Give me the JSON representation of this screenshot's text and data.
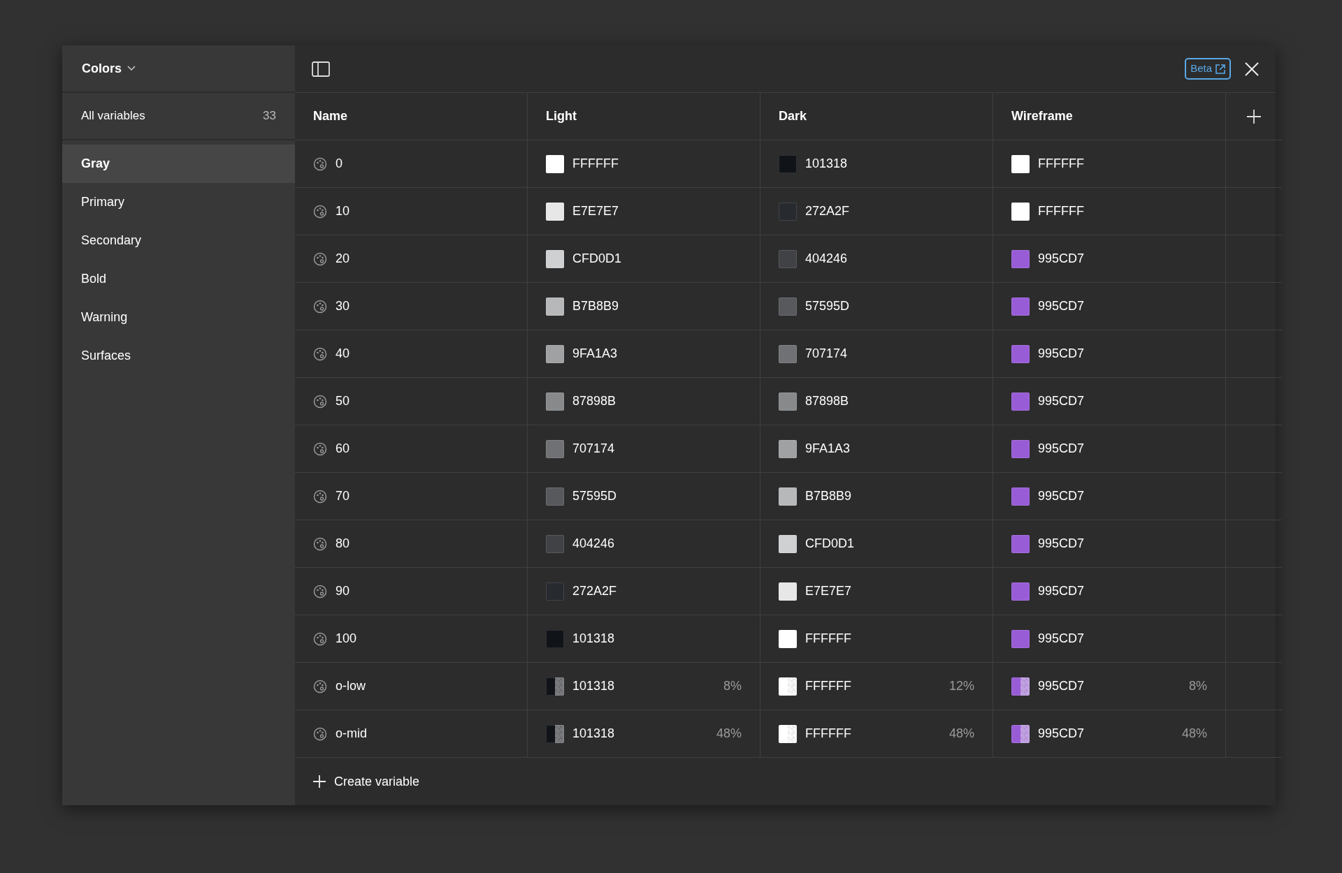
{
  "collection": {
    "title": "Colors"
  },
  "sidebar": {
    "all": {
      "label": "All variables",
      "count": "33"
    },
    "groups": [
      {
        "label": "Gray",
        "selected": true
      },
      {
        "label": "Primary",
        "selected": false
      },
      {
        "label": "Secondary",
        "selected": false
      },
      {
        "label": "Bold",
        "selected": false
      },
      {
        "label": "Warning",
        "selected": false
      },
      {
        "label": "Surfaces",
        "selected": false
      }
    ]
  },
  "toolbar": {
    "badge": "Beta"
  },
  "table": {
    "columns": [
      "Name",
      "Light",
      "Dark",
      "Wireframe"
    ],
    "rows": [
      {
        "name": "0",
        "values": [
          {
            "hex": "FFFFFF",
            "color": "#ffffff"
          },
          {
            "hex": "101318",
            "color": "#101318"
          },
          {
            "hex": "FFFFFF",
            "color": "#ffffff"
          }
        ]
      },
      {
        "name": "10",
        "values": [
          {
            "hex": "E7E7E7",
            "color": "#e7e7e7"
          },
          {
            "hex": "272A2F",
            "color": "#272a2f"
          },
          {
            "hex": "FFFFFF",
            "color": "#ffffff"
          }
        ]
      },
      {
        "name": "20",
        "values": [
          {
            "hex": "CFD0D1",
            "color": "#cfd0d1"
          },
          {
            "hex": "404246",
            "color": "#404246"
          },
          {
            "hex": "995CD7",
            "color": "#995cd7"
          }
        ]
      },
      {
        "name": "30",
        "values": [
          {
            "hex": "B7B8B9",
            "color": "#b7b8b9"
          },
          {
            "hex": "57595D",
            "color": "#57595d"
          },
          {
            "hex": "995CD7",
            "color": "#995cd7"
          }
        ]
      },
      {
        "name": "40",
        "values": [
          {
            "hex": "9FA1A3",
            "color": "#9fa1a3"
          },
          {
            "hex": "707174",
            "color": "#707174"
          },
          {
            "hex": "995CD7",
            "color": "#995cd7"
          }
        ]
      },
      {
        "name": "50",
        "values": [
          {
            "hex": "87898B",
            "color": "#87898b"
          },
          {
            "hex": "87898B",
            "color": "#87898b"
          },
          {
            "hex": "995CD7",
            "color": "#995cd7"
          }
        ]
      },
      {
        "name": "60",
        "values": [
          {
            "hex": "707174",
            "color": "#707174"
          },
          {
            "hex": "9FA1A3",
            "color": "#9fa1a3"
          },
          {
            "hex": "995CD7",
            "color": "#995cd7"
          }
        ]
      },
      {
        "name": "70",
        "values": [
          {
            "hex": "57595D",
            "color": "#57595d"
          },
          {
            "hex": "B7B8B9",
            "color": "#b7b8b9"
          },
          {
            "hex": "995CD7",
            "color": "#995cd7"
          }
        ]
      },
      {
        "name": "80",
        "values": [
          {
            "hex": "404246",
            "color": "#404246"
          },
          {
            "hex": "CFD0D1",
            "color": "#cfd0d1"
          },
          {
            "hex": "995CD7",
            "color": "#995cd7"
          }
        ]
      },
      {
        "name": "90",
        "values": [
          {
            "hex": "272A2F",
            "color": "#272a2f"
          },
          {
            "hex": "E7E7E7",
            "color": "#e7e7e7"
          },
          {
            "hex": "995CD7",
            "color": "#995cd7"
          }
        ]
      },
      {
        "name": "100",
        "values": [
          {
            "hex": "101318",
            "color": "#101318"
          },
          {
            "hex": "FFFFFF",
            "color": "#ffffff"
          },
          {
            "hex": "995CD7",
            "color": "#995cd7"
          }
        ]
      },
      {
        "name": "o-low",
        "values": [
          {
            "hex": "101318",
            "color": "#101318",
            "opacity": "8%"
          },
          {
            "hex": "FFFFFF",
            "color": "#ffffff",
            "opacity": "12%"
          },
          {
            "hex": "995CD7",
            "color": "#995cd7",
            "opacity": "8%"
          }
        ]
      },
      {
        "name": "o-mid",
        "values": [
          {
            "hex": "101318",
            "color": "#101318",
            "opacity": "48%"
          },
          {
            "hex": "FFFFFF",
            "color": "#ffffff",
            "opacity": "48%"
          },
          {
            "hex": "995CD7",
            "color": "#995cd7",
            "opacity": "48%"
          }
        ]
      }
    ]
  },
  "footer": {
    "create": "Create variable"
  }
}
